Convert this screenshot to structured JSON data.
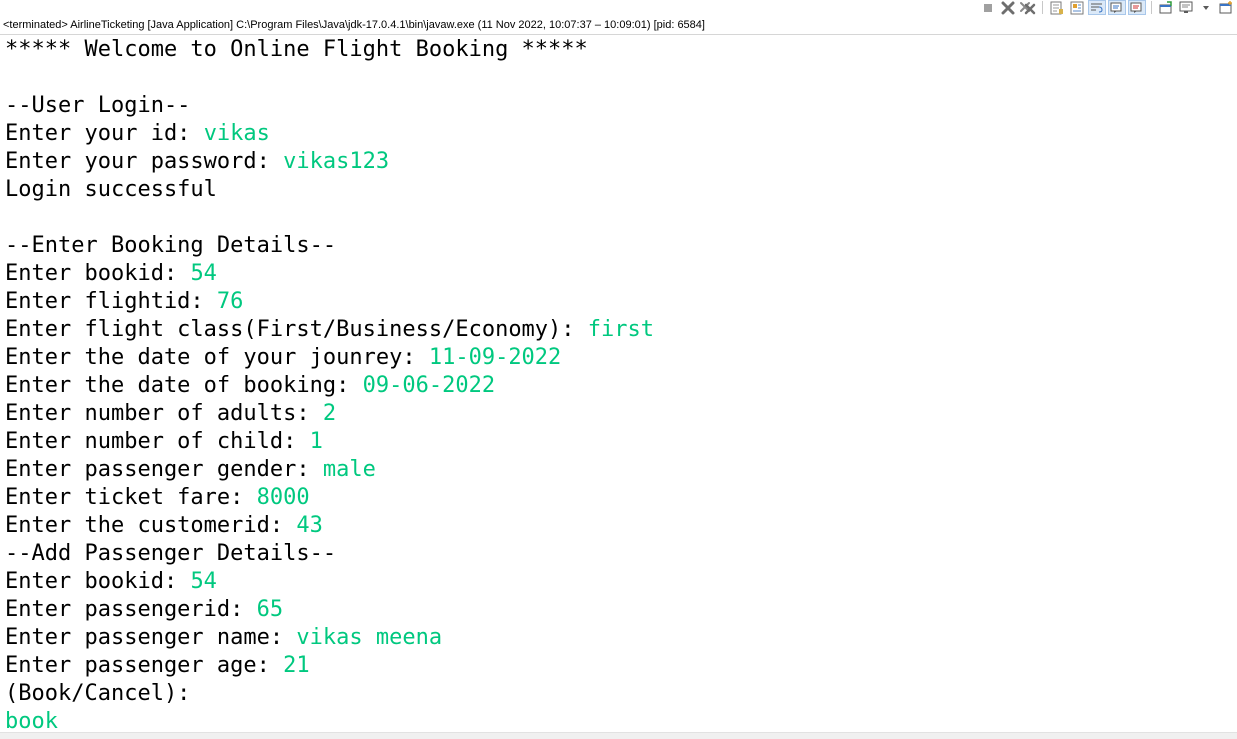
{
  "console_header": {
    "status": "<terminated> AirlineTicketing [Java Application] C:\\Program Files\\Java\\jdk-17.0.4.1\\bin\\javaw.exe  (11 Nov 2022, 10:07:37 – 10:09:01) [pid: 6584]"
  },
  "toolbar": {
    "icons": [
      "terminate-icon",
      "remove-launch-icon",
      "remove-all-terminated-icon",
      "clear-console-icon",
      "scroll-lock-icon",
      "word-wrap-icon",
      "show-when-stdout-icon",
      "show-when-stderr-icon",
      "pin-console-icon",
      "display-console-icon",
      "dropdown-arrow-icon",
      "open-console-icon"
    ]
  },
  "colors": {
    "output": "#000000",
    "input": "#00c87f"
  },
  "console_lines": [
    {
      "text": "***** Welcome to Online Flight Booking *****",
      "input": ""
    },
    {
      "text": "",
      "input": ""
    },
    {
      "text": "--User Login--",
      "input": ""
    },
    {
      "text": "Enter your id: ",
      "input": "vikas"
    },
    {
      "text": "Enter your password: ",
      "input": "vikas123"
    },
    {
      "text": "Login successful",
      "input": ""
    },
    {
      "text": "",
      "input": ""
    },
    {
      "text": "--Enter Booking Details--",
      "input": ""
    },
    {
      "text": "Enter bookid: ",
      "input": "54"
    },
    {
      "text": "Enter flightid: ",
      "input": "76"
    },
    {
      "text": "Enter flight class(First/Business/Economy): ",
      "input": "first"
    },
    {
      "text": "Enter the date of your jounrey: ",
      "input": "11-09-2022"
    },
    {
      "text": "Enter the date of booking: ",
      "input": "09-06-2022"
    },
    {
      "text": "Enter number of adults: ",
      "input": "2"
    },
    {
      "text": "Enter number of child: ",
      "input": "1"
    },
    {
      "text": "Enter passenger gender: ",
      "input": "male"
    },
    {
      "text": "Enter ticket fare: ",
      "input": "8000"
    },
    {
      "text": "Enter the customerid: ",
      "input": "43"
    },
    {
      "text": "--Add Passenger Details--",
      "input": ""
    },
    {
      "text": "Enter bookid: ",
      "input": "54"
    },
    {
      "text": "Enter passengerid: ",
      "input": "65"
    },
    {
      "text": "Enter passenger name: ",
      "input": "vikas meena"
    },
    {
      "text": "Enter passenger age: ",
      "input": "21"
    },
    {
      "text": "(Book/Cancel): ",
      "input": ""
    },
    {
      "text": "",
      "input": "book"
    }
  ]
}
